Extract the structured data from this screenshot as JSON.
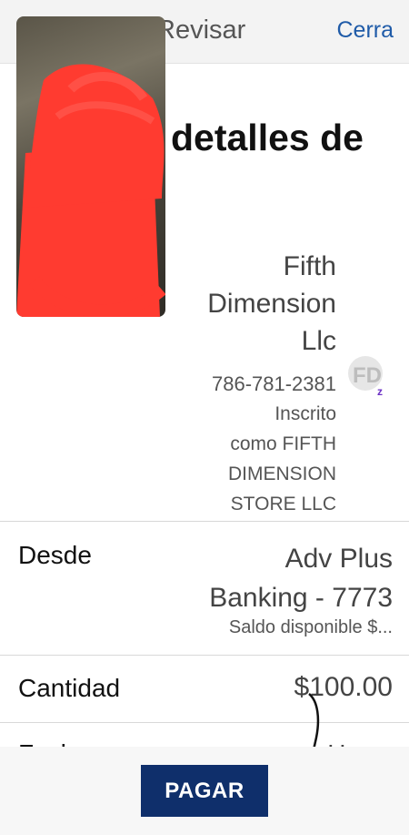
{
  "header": {
    "title": "Revisar",
    "close_label": "Cerra"
  },
  "heading": "detalles de",
  "payee": {
    "name_lines": [
      "Fifth",
      "Dimension",
      "Llc"
    ],
    "phone": "786-781-2381",
    "registered_lines": [
      "Inscrito",
      "como FIFTH",
      "DIMENSION",
      "STORE LLC"
    ],
    "logo_icon": "fd-logo-icon"
  },
  "from": {
    "label": "Desde",
    "account_lines": [
      "Adv Plus",
      "Banking - 7773"
    ],
    "balance": "Saldo disponible $..."
  },
  "amount": {
    "label": "Cantidad",
    "value": "$100.00"
  },
  "next_row": {
    "label": "Fecha",
    "value": "Hoy"
  },
  "footer": {
    "pay_label": "PAGAR"
  },
  "colors": {
    "accent": "#1f5ba8",
    "button": "#0f2f6b",
    "redaction": "#ff3b30"
  }
}
